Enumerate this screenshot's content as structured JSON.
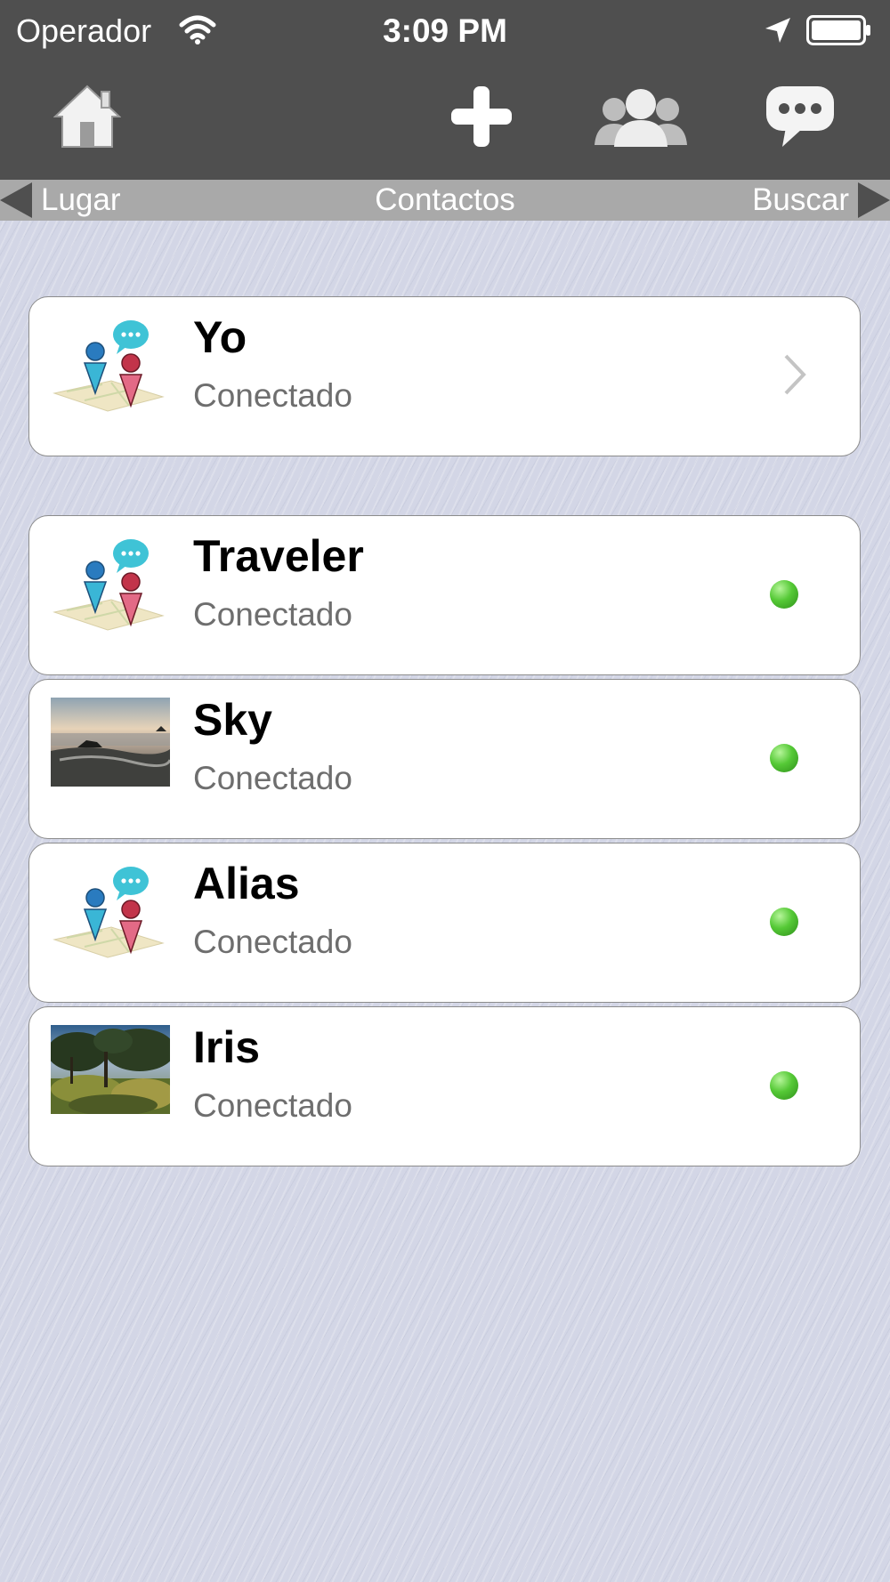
{
  "status_bar": {
    "carrier": "Operador",
    "time": "3:09 PM"
  },
  "toolbar": {
    "buttons": [
      "home-icon",
      "add-icon",
      "contacts-icon",
      "chat-icon"
    ]
  },
  "nav": {
    "prev_label": "Lugar",
    "title": "Contactos",
    "next_label": "Buscar"
  },
  "me": {
    "name": "Yo",
    "status": "Conectado",
    "avatar": "app-logo-icon"
  },
  "contacts": [
    {
      "name": "Traveler",
      "status": "Conectado",
      "avatar": "app-logo-icon",
      "online": true
    },
    {
      "name": "Sky",
      "status": "Conectado",
      "avatar": "sea-rocks-photo",
      "online": true
    },
    {
      "name": "Alias",
      "status": "Conectado",
      "avatar": "app-logo-icon",
      "online": true
    },
    {
      "name": "Iris",
      "status": "Conectado",
      "avatar": "trees-photo",
      "online": true
    }
  ],
  "colors": {
    "toolbar_bg": "#4f4f4f",
    "nav_strip_bg": "#a9a9a9",
    "online_green": "#55c936",
    "page_bg": "#d3d6e6"
  }
}
